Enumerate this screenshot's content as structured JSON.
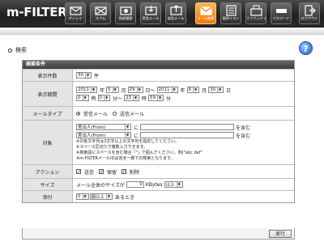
{
  "app": {
    "logo": "m-FILTER."
  },
  "nav": [
    {
      "label": "ディレイ",
      "icon": "delay-icon"
    },
    {
      "label": "スパム",
      "icon": "spam-icon"
    },
    {
      "label": "保留場理",
      "icon": "hold-icon"
    },
    {
      "label": "受信メール",
      "icon": "inbox-icon"
    },
    {
      "label": "送信メール",
      "icon": "send-mail-icon"
    },
    {
      "label": "メール検索",
      "icon": "mail-search-icon",
      "active": true
    },
    {
      "label": "個所リスト",
      "icon": "list-icon"
    },
    {
      "label": "ファクシミリ",
      "icon": "fax-icon"
    },
    {
      "label": "パスワード",
      "icon": "password-icon"
    },
    {
      "label": "ログアウト",
      "icon": "logout-icon"
    }
  ],
  "page": {
    "title": "検索",
    "help": "?"
  },
  "form": {
    "header": "検索条件",
    "count": {
      "label": "表示件数",
      "value": "30",
      "unit": "件"
    },
    "period": {
      "label": "表示期間",
      "from_year": "2011",
      "from_month": "5",
      "from_day": "29",
      "sep": "日～",
      "to_year": "2011",
      "to_month": "6",
      "to_day": "30",
      "hour_from": "0",
      "min_from": "0",
      "hour_to": "23",
      "min_to": "59",
      "y": "年",
      "m": "月",
      "d": "日",
      "h": "時",
      "mi": "分～",
      "mi_end": "分"
    },
    "mailtype": {
      "label": "メールタイプ",
      "opt1": "受信メール",
      "opt2": "送信メール"
    },
    "target": {
      "label": "対象",
      "field1": "差出人(From)",
      "field2": "差出人(From)",
      "joiner": "に",
      "suffix": "を含む",
      "notes": [
        "※対象文字列は3文字以上の文字列を指定してください。",
        "※スペース区切りで複数入力できます。",
        "※検索語にスペースを含む場合「\"」で囲んでください。例)\"abc def\"",
        "※m-FILTERメールIDは完全一致での検索となります。"
      ]
    },
    "action": {
      "label": "アクション",
      "opt1": "送信",
      "opt2": "保留",
      "opt3": "削除"
    },
    "size": {
      "label": "サイズ",
      "prefix": "メール全体のサイズが",
      "value": "0",
      "unit": "KBytes",
      "cmp": "以上"
    },
    "attach": {
      "label": "添付",
      "count": "0",
      "cmp": "個以上",
      "suffix": "あるとき"
    },
    "submit": "実行"
  }
}
